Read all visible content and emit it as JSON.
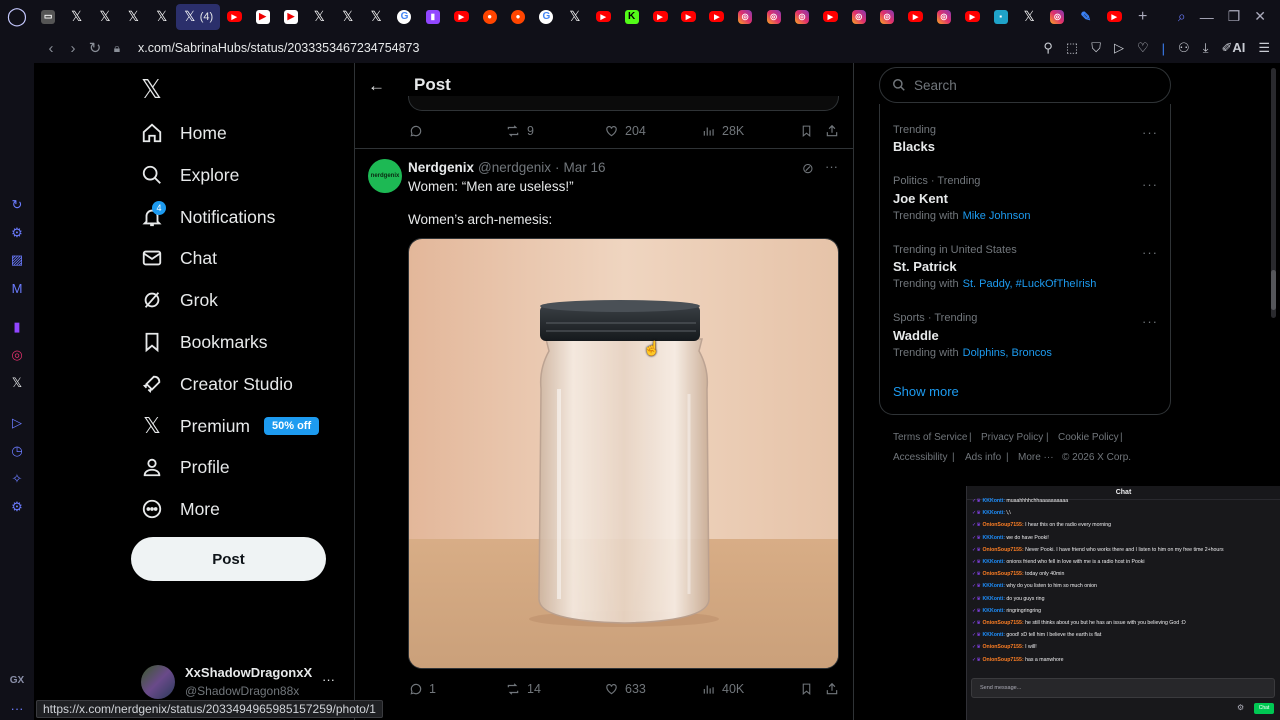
{
  "browser": {
    "url": "x.com/SabrinaHubs/status/2033353467234754873",
    "active_tab_label": "(4)",
    "status_link": "https://x.com/nerdgenix/status/2033494965985157259/photo/1",
    "ai_label": "AI",
    "gx_label": "GX"
  },
  "nav": {
    "home": "Home",
    "explore": "Explore",
    "notifications": "Notifications",
    "notifications_badge": "4",
    "chat": "Chat",
    "grok": "Grok",
    "bookmarks": "Bookmarks",
    "creator_studio": "Creator Studio",
    "premium": "Premium",
    "premium_promo": "50% off",
    "profile": "Profile",
    "more": "More",
    "post_button": "Post"
  },
  "account": {
    "display_name": "XxShadowDragonxX",
    "handle": "@ShadowDragon88x"
  },
  "main": {
    "header_title": "Post",
    "prev_post": {
      "replies": "",
      "reposts": "9",
      "likes": "204",
      "views": "28K"
    },
    "post": {
      "author": "Nerdgenix",
      "handle": "@nerdgenix",
      "date": "Mar 16",
      "text_line1": "Women: “Men are useless!”",
      "text_line2": "Women’s arch-nemesis:",
      "replies": "1",
      "reposts": "14",
      "likes": "633",
      "views": "40K",
      "avatar_text": "nerdgenix"
    }
  },
  "sidebar_right": {
    "search_placeholder": "Search",
    "trends": [
      {
        "meta": "Trending",
        "name": "Blacks",
        "with_label": "",
        "with_links": ""
      },
      {
        "meta": "Politics · Trending",
        "name": "Joe Kent",
        "with_label": "Trending with",
        "with_links": "Mike Johnson"
      },
      {
        "meta": "Trending in United States",
        "name": "St. Patrick",
        "with_label": "Trending with",
        "with_links": "St. Paddy, #LuckOfTheIrish"
      },
      {
        "meta": "Sports · Trending",
        "name": "Waddle",
        "with_label": "Trending with",
        "with_links": "Dolphins, Broncos"
      }
    ],
    "show_more": "Show more",
    "footer": {
      "terms": "Terms of Service",
      "privacy": "Privacy Policy",
      "cookie": "Cookie Policy",
      "accessibility": "Accessibility",
      "ads": "Ads info",
      "more": "More ···",
      "copyright": "© 2026 X Corp."
    }
  },
  "chat": {
    "title": "Chat",
    "messages": [
      {
        "user": "KKKonti:",
        "text": "muaahhhhchhaaaaaaaaaa"
      },
      {
        "user": "KKKonti:",
        "text": "\\,\\"
      },
      {
        "user": "OnionSoup7155:",
        "text": "I hear this on the radio every morning"
      },
      {
        "user": "KKKonti:",
        "text": "we do have Pooki!"
      },
      {
        "user": "OnionSoup7155:",
        "text": "Never Pooki. I have friend who works there and I listen to him on my free time 2+hours"
      },
      {
        "user": "KKKonti:",
        "text": "onions friend who fell in love with me is a radio host in Pooki"
      },
      {
        "user": "OnionSoup7155:",
        "text": "today only 40min"
      },
      {
        "user": "KKKonti:",
        "text": "why do you listen to him so much onion"
      },
      {
        "user": "KKKonti:",
        "text": "do you guys ring"
      },
      {
        "user": "KKKonti:",
        "text": "ringringringring"
      },
      {
        "user": "OnionSoup7155:",
        "text": "he still thinks about you but he has an issue with you believing God :D"
      },
      {
        "user": "KKKonti:",
        "text": "good! xD tell him I believe the earth is flat"
      },
      {
        "user": "OnionSoup7155:",
        "text": "I will!"
      },
      {
        "user": "OnionSoup7155:",
        "text": "has a manwhore"
      }
    ],
    "input_placeholder": "Send message...",
    "send_label": "Chat"
  }
}
